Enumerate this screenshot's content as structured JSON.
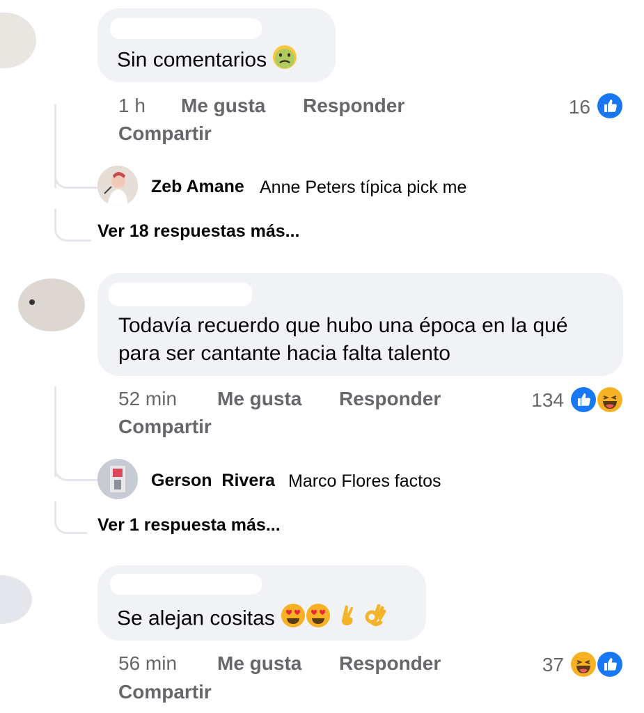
{
  "comments": [
    {
      "text": "Sin comentarios",
      "emoji": [
        "nauseated-face"
      ],
      "time": "1 h",
      "like_label": "Me gusta",
      "reply_label": "Responder",
      "share_label": "Compartir",
      "reaction_count": "16",
      "reactions": [
        "like"
      ],
      "reply": {
        "author": "Zeb Amane",
        "text": "Anne Peters típica pick me"
      },
      "more_replies": "Ver 18 respuestas más..."
    },
    {
      "text_line1": "Todavía recuerdo que hubo una época en la qué",
      "text_line2": "para ser cantante hacia falta talento",
      "time": "52 min",
      "like_label": "Me gusta",
      "reply_label": "Responder",
      "share_label": "Compartir",
      "reaction_count": "134",
      "reactions": [
        "like",
        "haha"
      ],
      "reply": {
        "author": "Gerson  Rivera",
        "text": "Marco Flores factos"
      },
      "more_replies": "Ver 1 respuesta más..."
    },
    {
      "text": "Se alejan cositas",
      "emoji": [
        "heart-eyes",
        "heart-eyes",
        "crossed-fingers",
        "ok-hand"
      ],
      "time": "56 min",
      "like_label": "Me gusta",
      "reply_label": "Responder",
      "share_label": "Compartir",
      "reaction_count": "37",
      "reactions": [
        "haha",
        "like"
      ]
    }
  ],
  "colors": {
    "bubble": "#f0f2f5",
    "meta_text": "#65676b",
    "like_blue": "#1877f2",
    "haha_yellow": "#f7b125"
  }
}
